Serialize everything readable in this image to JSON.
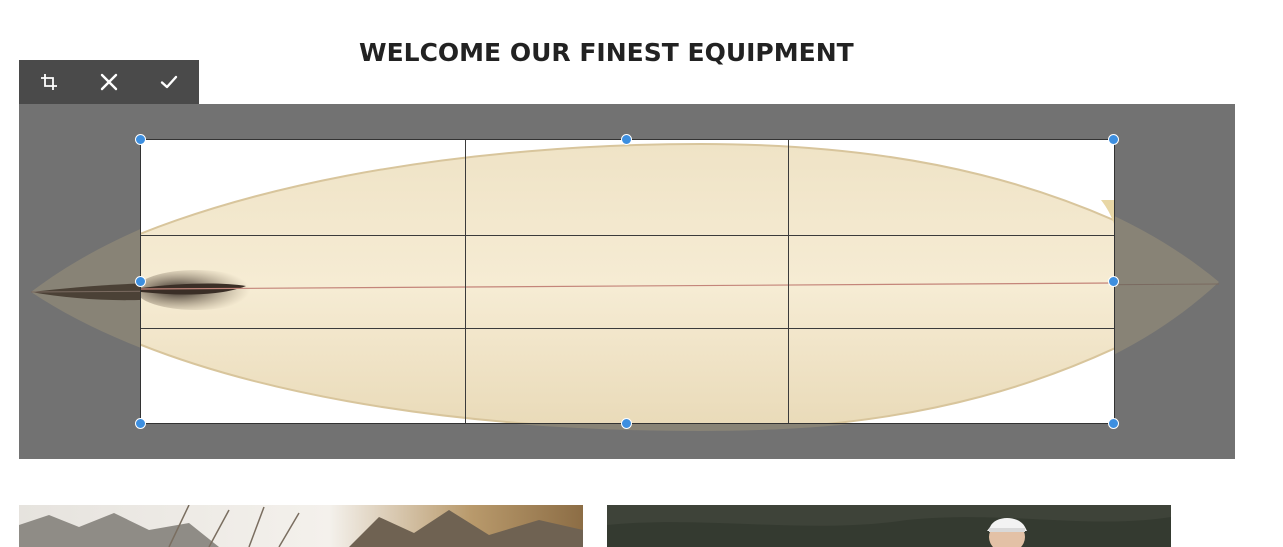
{
  "page": {
    "title": "WELCOME OUR FINEST EQUIPMENT"
  },
  "crop_toolbar": {
    "buttons": [
      {
        "icon": "crop-icon"
      },
      {
        "icon": "close-icon"
      },
      {
        "icon": "check-icon"
      }
    ],
    "background": "#4a4a4a",
    "icon_color": "#ffffff"
  },
  "crop_editor": {
    "overlay_color": "#727272",
    "handle_color": "#3d8fe0",
    "grid": "3x3",
    "image": "surfboard"
  },
  "gallery": {
    "items": [
      {
        "image": "mountain-trees-photo"
      },
      {
        "image": "person-with-visor-photo"
      }
    ]
  }
}
